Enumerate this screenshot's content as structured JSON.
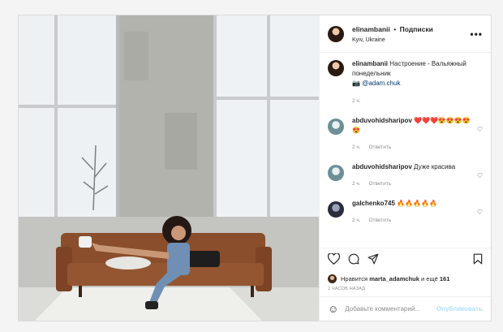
{
  "header": {
    "username": "elinambanii",
    "separator": "•",
    "follow_label": "Подписки",
    "location": "Kyiv, Ukraine",
    "more_icon": "more-horizontal-icon"
  },
  "caption": {
    "username": "elinambanii",
    "text": "Настроение - Вальяжный понедельник",
    "camera_emoji": "📷",
    "mention": "@adam.chuk",
    "time": "2 ч."
  },
  "comments": [
    {
      "username": "abduvohidsharipov",
      "text": "❤️❤️❤️😍😍😍😍😍",
      "time": "2 ч.",
      "reply": "Ответить"
    },
    {
      "username": "abduvohidsharipov",
      "text": "Дуже красива",
      "time": "2 ч.",
      "reply": "Ответить"
    },
    {
      "username": "galchenko745",
      "text": "🔥🔥🔥🔥🔥",
      "time": "2 ч.",
      "reply": "Ответить"
    }
  ],
  "actions": {
    "like_icon": "heart-icon",
    "comment_icon": "comment-icon",
    "share_icon": "paper-plane-icon",
    "save_icon": "bookmark-icon"
  },
  "likes": {
    "prefix": "Нравится",
    "user": "marta_adamchuk",
    "middle": "и ещё",
    "count": "161"
  },
  "post_time": "2 ЧАСОВ НАЗАД",
  "add_comment": {
    "emoji_icon": "smiley-icon",
    "placeholder": "Добавьте комментарий...",
    "publish": "Опубликовать"
  },
  "colors": {
    "border": "#dbdbdb",
    "muted": "#8e8e8e",
    "link": "#00376b",
    "publish_disabled": "#b2dffc"
  }
}
